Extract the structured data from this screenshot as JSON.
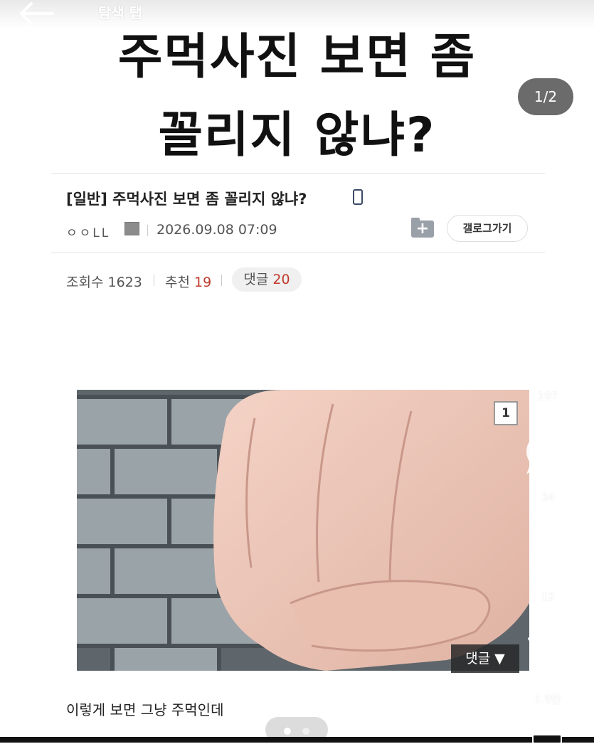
{
  "header": {
    "tab_label": "탐색 탭",
    "headline_line1": "주먹사진 보면 좀",
    "headline_line2": "꼴리지 않냐?",
    "page_indicator": "1/2"
  },
  "post": {
    "title": "[일반] 주먹사진 보면 좀 꼴리지 않냐?",
    "author": "ㅇㅇLL",
    "date": "2026.09.08 07:09",
    "gallery_button": "갤로그가기",
    "folder_icon_glyph": "+",
    "views_label": "조회수 1623",
    "recommend_label": "추천",
    "recommend_count": "19",
    "comment_label": "댓글",
    "comment_count": "20",
    "image_number": "1",
    "image_comment_overlay": "댓글 ▼",
    "caption": "이렇게 보면 그냥 주먹인데"
  },
  "rail": {
    "like_count": "197",
    "comment_count": "34",
    "share_count": "13",
    "send_count": "1.9만"
  },
  "colors": {
    "accent_red": "#c0392b",
    "pill_bg": "#f0f0f0",
    "page_indicator_bg": "#6b6b6b"
  }
}
